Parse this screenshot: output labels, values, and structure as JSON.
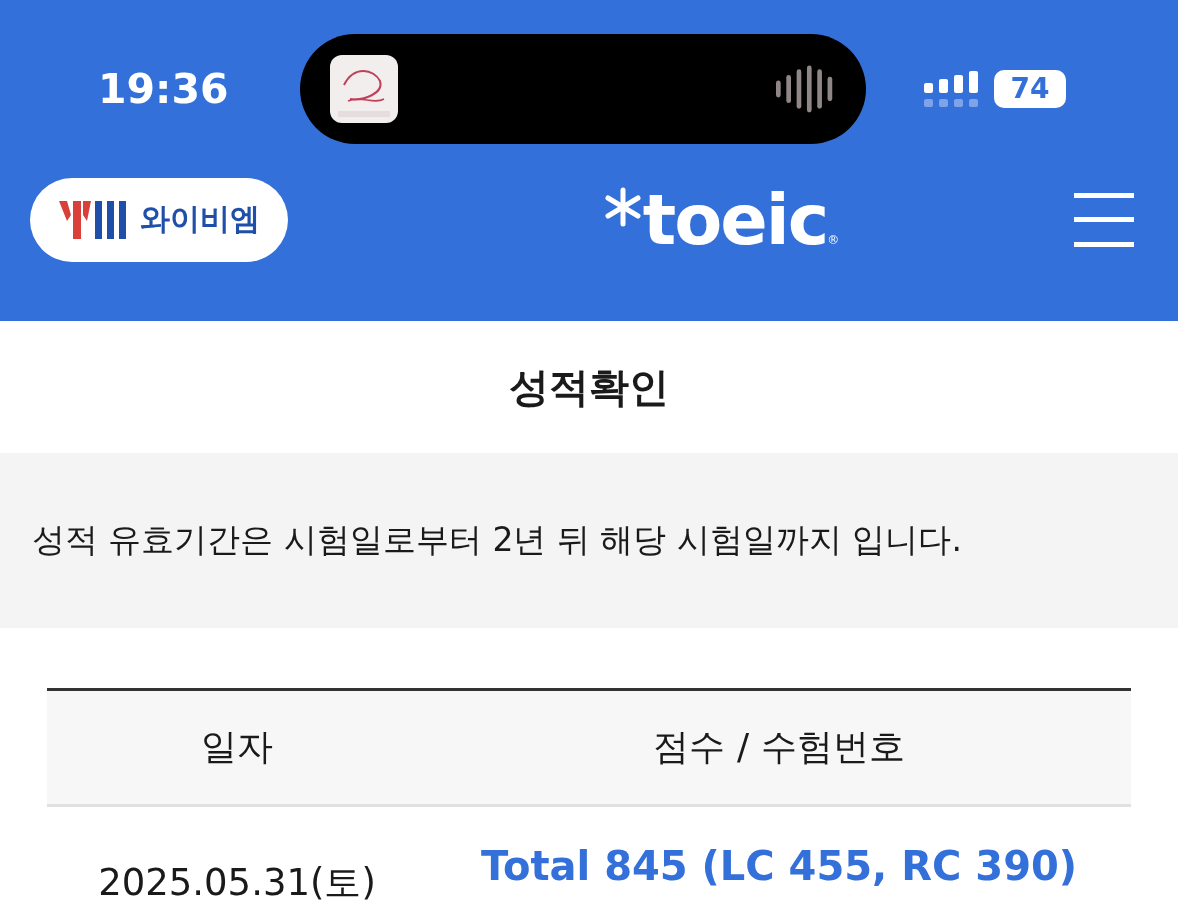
{
  "status_bar": {
    "time": "19:36",
    "battery": "74"
  },
  "header": {
    "brand": "와이비엠",
    "logo_text": "toeic",
    "registered_mark": "®"
  },
  "page_title": "성적확인",
  "notice": "성적 유효기간은 시험일로부터 2년 뒤 해당 시험일까지 입니다.",
  "table": {
    "columns": [
      "일자",
      "점수 / 수험번호"
    ],
    "rows": [
      {
        "date": "2025.05.31(토)",
        "score": "Total 845 (LC 455, RC 390)"
      }
    ]
  }
}
